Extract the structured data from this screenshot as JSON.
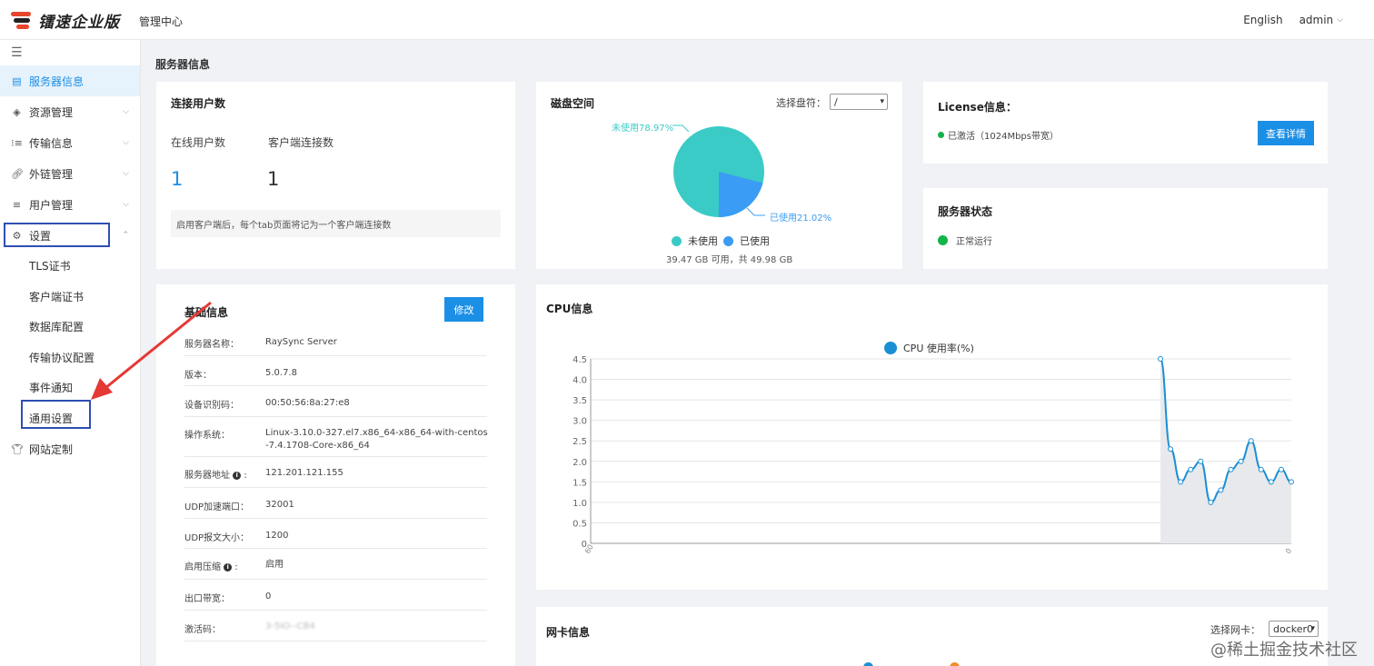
{
  "header": {
    "brand": "镭速企业版",
    "center": "管理中心",
    "language": "English",
    "user": "admin"
  },
  "sidebar": {
    "items": [
      {
        "label": "服务器信息",
        "icon": "server-icon"
      },
      {
        "label": "资源管理",
        "icon": "layers-icon"
      },
      {
        "label": "传输信息",
        "icon": "list-icon"
      },
      {
        "label": "外链管理",
        "icon": "link-icon"
      },
      {
        "label": "用户管理",
        "icon": "users-icon"
      },
      {
        "label": "设置",
        "icon": "gear-icon"
      },
      {
        "label": "网站定制",
        "icon": "shirt-icon"
      }
    ],
    "sub_items": [
      "TLS证书",
      "客户端证书",
      "数据库配置",
      "传输协议配置",
      "事件通知",
      "通用设置"
    ]
  },
  "main": {
    "title": "服务器信息",
    "users": {
      "title": "连接用户数",
      "online_label": "在线用户数",
      "client_label": "客户端连接数",
      "online_value": "1",
      "client_value": "1",
      "hint": "启用客户端后，每个tab页面将记为一个客户端连接数"
    },
    "disk": {
      "title": "磁盘空间",
      "select_label": "选择盘符：",
      "select_value": "/",
      "unused_label": "未使用78.97%",
      "used_label": "已使用21.02%",
      "legend_unused": "未使用",
      "legend_used": "已使用",
      "summary": "39.47 GB 可用，共 49.98 GB",
      "unused_pct": 78.97,
      "used_pct": 21.02,
      "colors": {
        "unused": "#3bcbc6",
        "used": "#3a9cf4"
      }
    },
    "license": {
      "title": "License信息：",
      "status": "已激活（1024Mbps带宽）",
      "button": "查看详情"
    },
    "server_status": {
      "title": "服务器状态",
      "status": "正常运行"
    },
    "basic": {
      "title": "基础信息",
      "edit_button": "修改",
      "rows": [
        {
          "k": "服务器名称：",
          "v": "RaySync Server"
        },
        {
          "k": "版本：",
          "v": "5.0.7.8"
        },
        {
          "k": "设备识别码：",
          "v": "00:50:56:8a:27:e8"
        },
        {
          "k": "操作系统：",
          "v": "Linux-3.10.0-327.el7.x86_64-x86_64-with-centos-7.4.1708-Core-x86_64"
        },
        {
          "k": "服务器地址",
          "v": "121.201.121.155"
        },
        {
          "k": "UDP加速端口：",
          "v": "32001"
        },
        {
          "k": "UDP报文大小：",
          "v": "1200"
        },
        {
          "k": "启用压缩",
          "v": "启用"
        },
        {
          "k": "出口带宽：",
          "v": "0"
        },
        {
          "k": "激活码：",
          "v": "3-5IO--CB4"
        }
      ]
    },
    "cpu": {
      "title": "CPU信息",
      "legend": "CPU 使用率(%)"
    },
    "nic": {
      "title": "网卡信息",
      "select_label": "选择网卡：",
      "select_value": "docker0"
    }
  },
  "chart_data": {
    "type": "area",
    "title": "CPU信息",
    "series": [
      {
        "name": "CPU 使用率(%)",
        "values": [
          4.5,
          2.3,
          1.5,
          1.8,
          2.0,
          1.0,
          1.3,
          1.8,
          2.0,
          2.5,
          1.8,
          1.5,
          1.8,
          1.5
        ]
      }
    ],
    "xlim": [
      60,
      0
    ],
    "x_tick_labels": [
      "60",
      "0"
    ],
    "ylim": [
      0,
      4.5
    ],
    "y_ticks": [
      "0",
      "0.5",
      "1.0",
      "1.5",
      "2.0",
      "2.5",
      "3.0",
      "3.5",
      "4.0",
      "4.5"
    ],
    "grid": true,
    "color": "#1b8fd4",
    "legend_position": "top-center"
  },
  "watermark": "@稀土掘金技术社区"
}
